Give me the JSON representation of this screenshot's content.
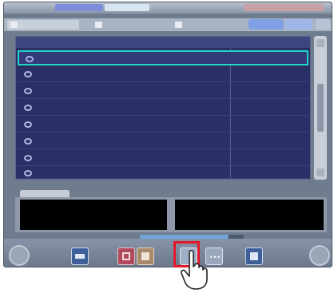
{
  "app": {
    "title": "",
    "colors": {
      "frame": "#6f7c8e",
      "list_bg": "#2a2f66",
      "selection": "#1fd6c2",
      "highlight": "#e4172a"
    }
  },
  "tabs": [
    {
      "label": "",
      "icon": "folder-icon",
      "active": true
    },
    {
      "label": "",
      "icon": "list-icon",
      "active": false
    },
    {
      "label": "",
      "icon": "image-icon",
      "active": false
    }
  ],
  "list": {
    "headers": [
      "",
      "",
      "",
      "",
      "",
      ""
    ],
    "rows": [
      {
        "text": "",
        "sub": "",
        "selected": true
      },
      {
        "text": "",
        "sub": "",
        "selected": false
      },
      {
        "text": "",
        "sub": "",
        "selected": false
      },
      {
        "text": "",
        "sub": "",
        "selected": false
      },
      {
        "text": "",
        "sub": "",
        "selected": false
      },
      {
        "text": "",
        "sub": "",
        "selected": false
      },
      {
        "text": "",
        "sub": "",
        "selected": false
      },
      {
        "text": "",
        "sub": "",
        "selected": false
      }
    ]
  },
  "detail": {
    "tab_label": "",
    "left_panel": {
      "line1": "",
      "line2": "",
      "line3": ""
    },
    "right_panel": {
      "line1": "",
      "line2": "",
      "line3": ""
    }
  },
  "progress_fraction": 0.85,
  "bottombar": {
    "buttons": [
      {
        "name": "home-button",
        "icon": "home-icon"
      },
      {
        "name": "print-button",
        "icon": "printer-icon"
      },
      {
        "name": "export-button",
        "icon": "export-icon"
      },
      {
        "name": "edit-button",
        "icon": "edit-icon"
      },
      {
        "name": "highlighted-button",
        "icon": "blank-icon"
      },
      {
        "name": "more-button",
        "icon": "ellipsis-icon"
      },
      {
        "name": "save-button",
        "icon": "disk-icon"
      },
      {
        "name": "exit-button",
        "icon": "power-icon"
      }
    ]
  }
}
